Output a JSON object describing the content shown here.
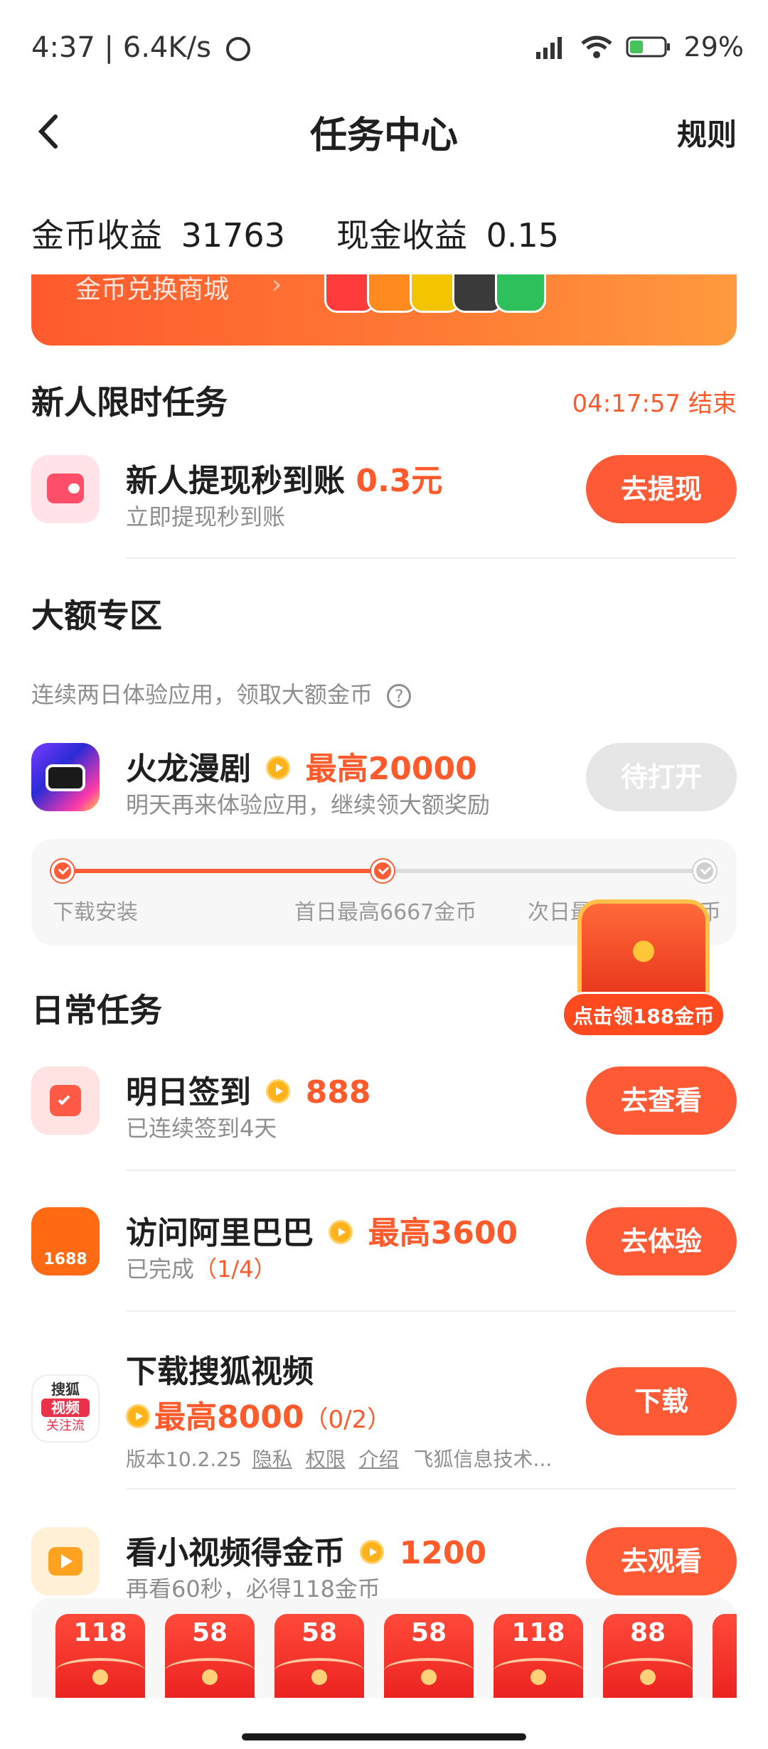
{
  "status_bar": {
    "time": "4:37",
    "speed": "6.4K/s",
    "battery": "29%"
  },
  "nav": {
    "title": "任务中心",
    "rule": "规则"
  },
  "earnings": {
    "coin_label": "金币收益",
    "coin_value": "31763",
    "cash_label": "现金收益",
    "cash_value": "0.15"
  },
  "banner": {
    "text": "金币兑换商城",
    "chevron": "›"
  },
  "newbie": {
    "title": "新人限时任务",
    "timer": "04:17:57 结束",
    "task": {
      "name": "新人提现秒到账",
      "reward": "0.3元",
      "sub": "立即提现秒到账",
      "button": "去提现"
    }
  },
  "big": {
    "title": "大额专区",
    "desc": "连续两日体验应用，领取大额金币",
    "task": {
      "name": "火龙漫剧",
      "reward": "最高20000",
      "sub": "明天再来体验应用，继续领大额奖励",
      "button": "待打开"
    },
    "steps": [
      "下载安装",
      "首日最高6667金币",
      "次日最"
    ],
    "step_tail": "币"
  },
  "treasure": {
    "label": "点击领188金币"
  },
  "daily": {
    "title": "日常任务",
    "tasks": [
      {
        "name": "明日签到",
        "reward": "888",
        "sub": "已连续签到4天",
        "button": "去查看"
      },
      {
        "name": "访问阿里巴巴",
        "reward": "最高3600",
        "sub": "已完成",
        "progress": "（1/4）",
        "button": "去体验",
        "icon_text": "1688"
      },
      {
        "name": "下载搜狐视频",
        "reward": "最高8000",
        "progress": "（0/2）",
        "sub": "版本10.2.25",
        "links": [
          "隐私",
          "权限",
          "介绍"
        ],
        "company": "飞狐信息技术...",
        "button": "下载",
        "icon_text": [
          "搜狐",
          "视频",
          "关注流"
        ]
      },
      {
        "name": "看小视频得金币",
        "reward": "1200",
        "sub": "再看60秒，必得118金币",
        "button": "去观看"
      }
    ]
  },
  "packets": [
    "118",
    "58",
    "58",
    "58",
    "118",
    "88"
  ],
  "colors": {
    "accent": "#ff5a36",
    "reward": "#ff5a2b",
    "muted": "#8e8e8e"
  }
}
